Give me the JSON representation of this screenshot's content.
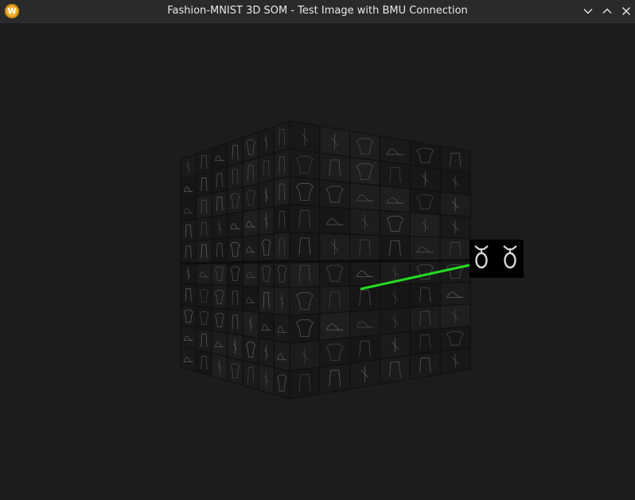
{
  "window": {
    "title": "Fashion-MNIST 3D SOM - Test Image with BMU Connection",
    "app_icon_letter": "W",
    "app_icon_color": "#f0b330"
  },
  "controls": {
    "minimize_icon": "chevron-down-icon",
    "maximize_icon": "chevron-up-icon",
    "close_icon": "close-icon"
  },
  "scene": {
    "background_color": "#1c1c1c",
    "cube_face_color": "#161616",
    "glyph_color": "#8a8a8a",
    "connection_color": "#22dd22",
    "grid_columns_front": 7,
    "grid_columns_right": 6,
    "grid_rows": 10
  }
}
